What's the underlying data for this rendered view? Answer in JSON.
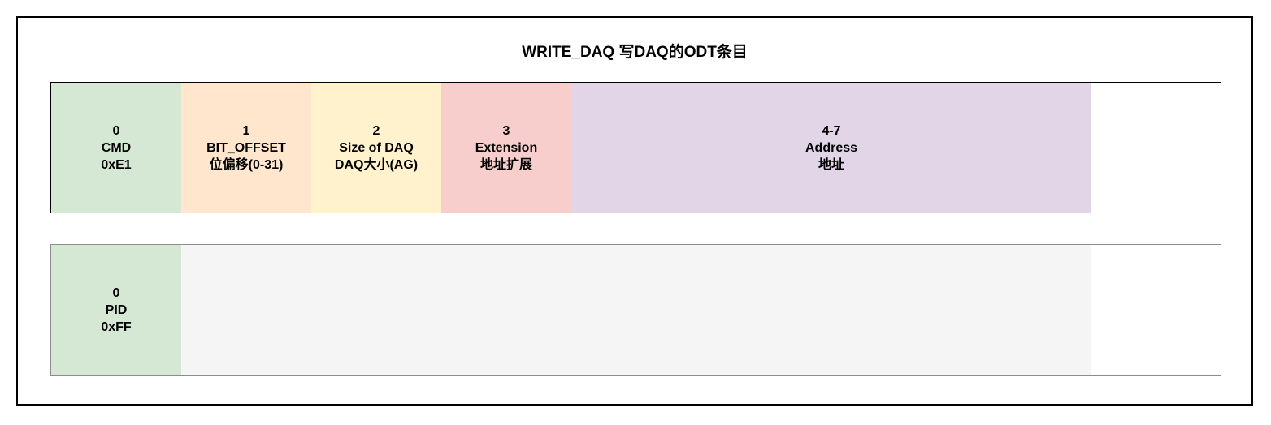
{
  "title": "WRITE_DAQ 写DAQ的ODT条目",
  "command_row": {
    "cells": [
      {
        "byte": "0",
        "name": "CMD",
        "value": "0xE1",
        "color": "#d5e8d4"
      },
      {
        "byte": "1",
        "name": "BIT_OFFSET",
        "value": "位偏移(0-31)",
        "color": "#ffe6cc"
      },
      {
        "byte": "2",
        "name": "Size of DAQ",
        "value": "DAQ大小(AG)",
        "color": "#fff2cc"
      },
      {
        "byte": "3",
        "name": "Extension",
        "value": "地址扩展",
        "color": "#f8cecc"
      },
      {
        "byte": "4-7",
        "name": "Address",
        "value": "地址",
        "color": "#e1d5e7"
      }
    ]
  },
  "response_row": {
    "cells": [
      {
        "byte": "0",
        "name": "PID",
        "value": "0xFF",
        "color": "#d5e8d4"
      }
    ],
    "filler_color": "#f5f5f5"
  }
}
